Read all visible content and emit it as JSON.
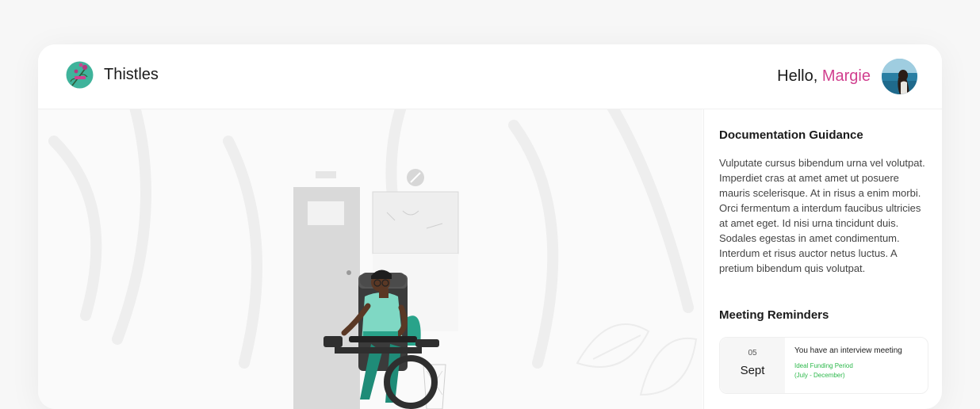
{
  "header": {
    "app_name": "Thistles",
    "greeting_prefix": "Hello, ",
    "user_name": "Margie",
    "logo_icon": "thistle-flower-icon",
    "avatar_icon": "user-avatar"
  },
  "sidebar": {
    "doc_title": "Documentation Guidance",
    "doc_body": "Vulputate cursus bibendum urna vel volutpat. Imperdiet cras at amet amet ut posuere mauris scelerisque. At in risus a enim morbi. Orci fermentum a interdum faucibus ultricies at amet eget. Id nisi urna tincidunt duis. Sodales egestas in amet condimentum. Interdum et risus auctor netus luctus. A pretium bibendum quis volutpat.",
    "meetings_title": "Meeting Reminders",
    "meetings": [
      {
        "day": "05",
        "month": "Sept",
        "text": "You have an interview meeting",
        "period_line1": "Ideal Funding Period",
        "period_line2": "(July - December)"
      }
    ]
  },
  "colors": {
    "accent": "#d1408f",
    "success": "#2cb84b",
    "teal": "#29a38a"
  },
  "illustration": "person-in-wheelchair-illustration"
}
